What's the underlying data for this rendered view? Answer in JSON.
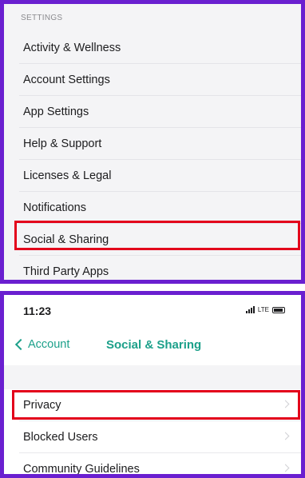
{
  "settings_panel": {
    "section_header": "SETTINGS",
    "items": [
      {
        "label": "Activity & Wellness"
      },
      {
        "label": "Account Settings"
      },
      {
        "label": "App Settings"
      },
      {
        "label": "Help & Support"
      },
      {
        "label": "Licenses & Legal"
      },
      {
        "label": "Notifications"
      },
      {
        "label": "Social & Sharing",
        "highlighted": true
      },
      {
        "label": "Third Party Apps"
      }
    ]
  },
  "social_panel": {
    "status_bar": {
      "time": "11:23",
      "network": "LTE"
    },
    "nav": {
      "back_label": "Account",
      "title": "Social & Sharing"
    },
    "items": [
      {
        "label": "Privacy",
        "highlighted": true
      },
      {
        "label": "Blocked Users"
      },
      {
        "label": "Community Guidelines"
      }
    ]
  },
  "colors": {
    "frame": "#6a1fd0",
    "highlight": "#e3001b",
    "accent": "#1ca08a"
  }
}
